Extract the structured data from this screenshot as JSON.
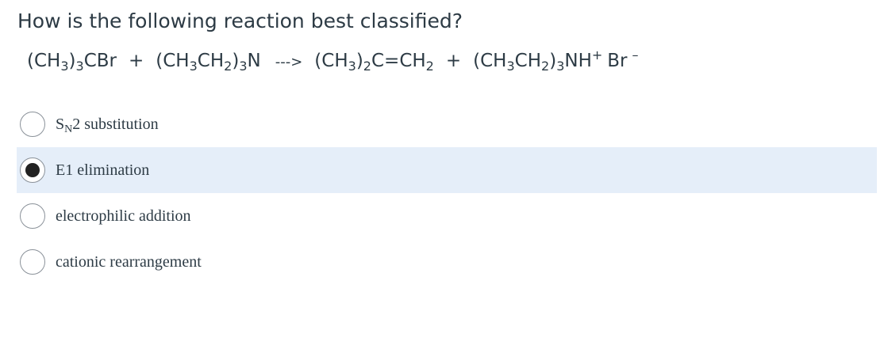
{
  "question": {
    "prompt": "How is the following reaction best classified?",
    "equation": {
      "reactant1": {
        "a": "(CH",
        "b": "3",
        "c": ")",
        "d": "3",
        "e": "CBr"
      },
      "plus1": "+",
      "reactant2": {
        "a": "(CH",
        "b": "3",
        "c": "CH",
        "d": "2",
        "e": ")",
        "f": "3",
        "g": "N"
      },
      "arrow": "--->",
      "product1": {
        "a": "(CH",
        "b": "3",
        "c": ")",
        "d": "2",
        "e": "C=CH",
        "f": "2"
      },
      "plus2": "+",
      "product2": {
        "a": "(CH",
        "b": "3",
        "c": "CH",
        "d": "2",
        "e": ")",
        "f": "3",
        "g": "NH",
        "h": "+",
        "i": "Br",
        "j": "–"
      }
    }
  },
  "answers": [
    {
      "label_main": "S",
      "label_sub": "N",
      "label_rest": "2 substitution",
      "selected": false
    },
    {
      "label": "E1 elimination",
      "selected": true
    },
    {
      "label": "electrophilic addition",
      "selected": false
    },
    {
      "label": "cationic rearrangement",
      "selected": false
    }
  ],
  "colors": {
    "text": "#2d3b45",
    "selected_row_background": "#e5eef9",
    "radio_border": "#8a9199",
    "radio_dot": "#222222"
  }
}
